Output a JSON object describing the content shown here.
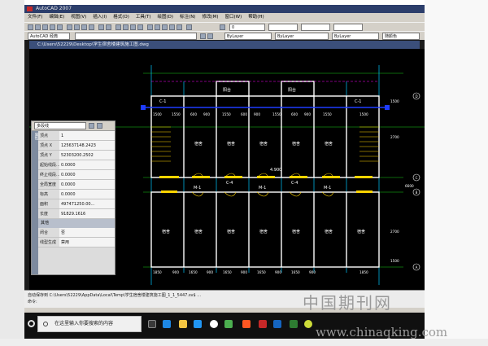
{
  "app_title": "AutoCAD 2007",
  "menu": [
    "文件(F)",
    "编辑(E)",
    "视图(V)",
    "插入(I)",
    "格式(O)",
    "工具(T)",
    "绘图(D)",
    "标注(N)",
    "修改(M)",
    "窗口(W)",
    "帮助(H)"
  ],
  "toolbar": {
    "workspace": "AutoCAD 经典",
    "layer_combo": "0",
    "color_combo": "ByLayer",
    "linetype_combo": "ByLayer",
    "lineweight_combo": "ByLayer",
    "plotstyle_combo": "随颜色"
  },
  "document_title": "C:\\Users\\52229\\Desktop\\学生宿舍楼建筑施工图.dwg",
  "properties": {
    "tab": "属性",
    "selection": "多段线",
    "rows": [
      {
        "name": "顶点",
        "value": "1"
      },
      {
        "name": "顶点 X",
        "value": "125637148.2423"
      },
      {
        "name": "顶点 Y",
        "value": "52303200.2502"
      },
      {
        "name": "起始线段...",
        "value": "0.0000"
      },
      {
        "name": "终止线段...",
        "value": "0.0000"
      },
      {
        "name": "全局宽度",
        "value": "0.0000"
      },
      {
        "name": "标高",
        "value": "0.0000"
      },
      {
        "name": "面积",
        "value": "497471250.00..."
      },
      {
        "name": "长度",
        "value": "91829.1616"
      }
    ],
    "section_other": "其他",
    "other_rows": [
      {
        "name": "闭合",
        "value": "否"
      },
      {
        "name": "线型生成",
        "value": "禁用"
      }
    ]
  },
  "plan": {
    "room_label": "宿舍",
    "balcony_label": "阳台",
    "elevation_label": "4.900",
    "axis_c_label": "C-1",
    "window_label": "C-4",
    "door_label": "M-1",
    "dimensions_top": [
      "1500",
      "1550",
      "600",
      "900",
      "1550",
      "600",
      "900",
      "1550",
      "600",
      "900",
      "1550",
      "1500"
    ],
    "dimensions_bottom": [
      "1850",
      "900",
      "1650",
      "900",
      "1650",
      "900",
      "1650",
      "900",
      "1650",
      "900",
      "1850"
    ],
    "right_dims": [
      "1500",
      "2700",
      "6600",
      "2700",
      "1500"
    ],
    "right_axis": [
      "A",
      "B",
      "C",
      "D"
    ]
  },
  "command_line": [
    "自动保存到 C:\\Users\\52229\\AppData\\Local\\Temp\\学生宿舍楼建筑施工图_1_1_5447.sv$ ...",
    "命令:"
  ],
  "taskbar": {
    "search_placeholder": "在这里输入你要搜索的内容"
  },
  "watermark": {
    "cn": "中国期刊网",
    "url": "www.chinaqking.com"
  },
  "colors": {
    "wall": "#ffffff",
    "axis": "#00c8ff",
    "grid_green": "#19d219",
    "window_yellow": "#ffd400",
    "magenta": "#ff00ff",
    "selection": "#1e3cff"
  }
}
